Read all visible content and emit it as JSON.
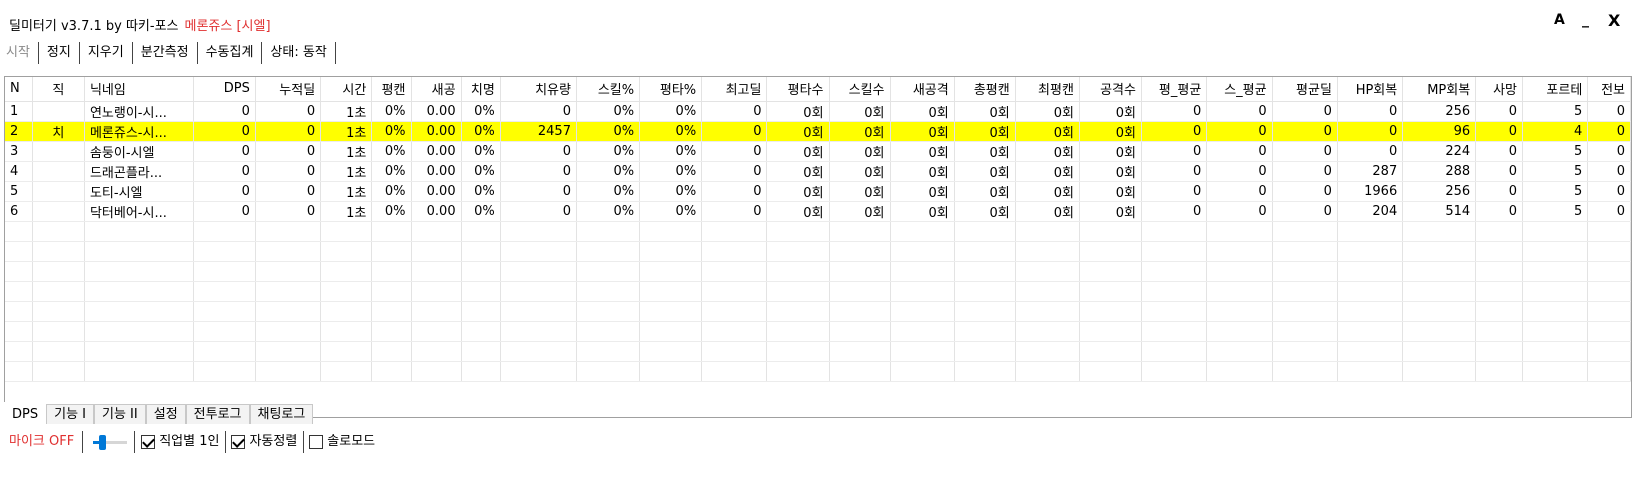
{
  "window": {
    "app_title": "딜미터기 v3.7.1 by 따키-포스",
    "character": "메론쥬스 [시엘]",
    "controls": [
      "A",
      "_",
      "X"
    ]
  },
  "toolbar": [
    "시작",
    "정지",
    "지우기",
    "분간측정",
    "수동집계",
    "상태: 동작"
  ],
  "columns": [
    "N",
    "직",
    "닉네임",
    "DPS",
    "누적딜",
    "시간",
    "평캔",
    "새공",
    "치명",
    "치유량",
    "스킬%",
    "평타%",
    "최고딜",
    "평타수",
    "스킬수",
    "새공격",
    "총평캔",
    "최평캔",
    "공격수",
    "평_평균",
    "스_평균",
    "평균딜",
    "HP회복",
    "MP회복",
    "사망",
    "포르테",
    "전보"
  ],
  "rows": [
    [
      "1",
      "",
      "연노랭이-시...",
      "0",
      "0",
      "1초",
      "0%",
      "0.00",
      "0%",
      "0",
      "0%",
      "0%",
      "0",
      "0회",
      "0회",
      "0회",
      "0회",
      "0회",
      "0회",
      "0",
      "0",
      "0",
      "0",
      "256",
      "0",
      "5",
      "0"
    ],
    [
      "2",
      "치",
      "메론쥬스-시...",
      "0",
      "0",
      "1초",
      "0%",
      "0.00",
      "0%",
      "2457",
      "0%",
      "0%",
      "0",
      "0회",
      "0회",
      "0회",
      "0회",
      "0회",
      "0회",
      "0",
      "0",
      "0",
      "0",
      "96",
      "0",
      "4",
      "0"
    ],
    [
      "3",
      "",
      "솜둥이-시엘",
      "0",
      "0",
      "1초",
      "0%",
      "0.00",
      "0%",
      "0",
      "0%",
      "0%",
      "0",
      "0회",
      "0회",
      "0회",
      "0회",
      "0회",
      "0회",
      "0",
      "0",
      "0",
      "0",
      "224",
      "0",
      "5",
      "0"
    ],
    [
      "4",
      "",
      "드래곤플라...",
      "0",
      "0",
      "1초",
      "0%",
      "0.00",
      "0%",
      "0",
      "0%",
      "0%",
      "0",
      "0회",
      "0회",
      "0회",
      "0회",
      "0회",
      "0회",
      "0",
      "0",
      "0",
      "287",
      "288",
      "0",
      "5",
      "0"
    ],
    [
      "5",
      "",
      "도티-시엘",
      "0",
      "0",
      "1초",
      "0%",
      "0.00",
      "0%",
      "0",
      "0%",
      "0%",
      "0",
      "0회",
      "0회",
      "0회",
      "0회",
      "0회",
      "0회",
      "0",
      "0",
      "0",
      "1966",
      "256",
      "0",
      "5",
      "0"
    ],
    [
      "6",
      "",
      "닥터베어-시...",
      "0",
      "0",
      "1초",
      "0%",
      "0.00",
      "0%",
      "0",
      "0%",
      "0%",
      "0",
      "0회",
      "0회",
      "0회",
      "0회",
      "0회",
      "0회",
      "0",
      "0",
      "0",
      "204",
      "514",
      "0",
      "5",
      "0"
    ]
  ],
  "highlight_row": 1,
  "highlight_color": "#ffff00",
  "tabs": [
    "DPS",
    "기능 I",
    "기능 II",
    "설정",
    "전투로그",
    "채팅로그"
  ],
  "bottom": {
    "mic": "마이크 OFF",
    "volume_level": 0.25,
    "checkboxes": [
      {
        "label": "직업별 1인",
        "checked": true
      },
      {
        "label": "자동정렬",
        "checked": true
      },
      {
        "label": "솔로모드",
        "checked": false
      }
    ]
  },
  "accent_colors": {
    "red_text": "#e03030",
    "slider": "#0078d7"
  }
}
